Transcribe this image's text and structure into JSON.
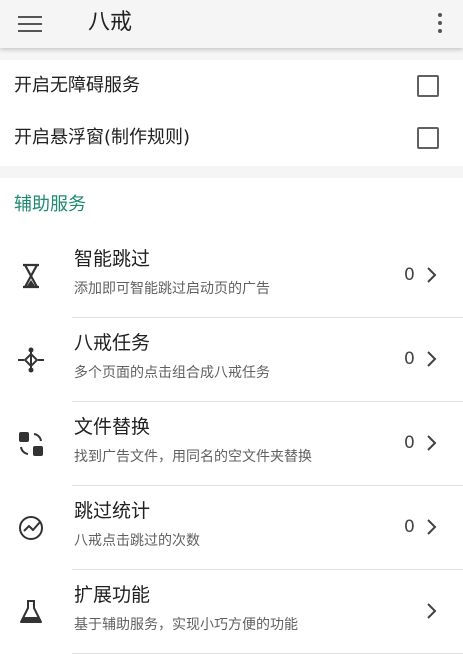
{
  "appbar": {
    "title": "八戒"
  },
  "toggles": [
    {
      "label": "开启无障碍服务",
      "checked": false
    },
    {
      "label": "开启悬浮窗(制作规则)",
      "checked": false
    }
  ],
  "services": {
    "section_title": "辅助服务",
    "items": [
      {
        "title": "智能跳过",
        "desc": "添加即可智能跳过启动页的广告",
        "count": "0",
        "icon": "hourglass-icon"
      },
      {
        "title": "八戒任务",
        "desc": "多个页面的点击组合成八戒任务",
        "count": "0",
        "icon": "task-flow-icon"
      },
      {
        "title": "文件替换",
        "desc": "找到广告文件，用同名的空文件夹替换",
        "count": "0",
        "icon": "file-swap-icon"
      },
      {
        "title": "跳过统计",
        "desc": "八戒点击跳过的次数",
        "count": "0",
        "icon": "stats-icon"
      },
      {
        "title": "扩展功能",
        "desc": "基于辅助服务，实现小巧方便的功能",
        "count": "",
        "icon": "flask-icon"
      }
    ]
  },
  "colors": {
    "accent": "#1f8a70",
    "background": "#f5f5f5",
    "card": "#ffffff"
  }
}
